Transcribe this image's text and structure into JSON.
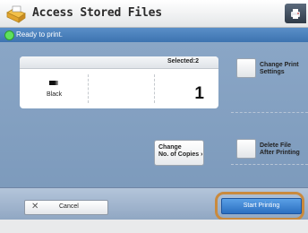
{
  "header": {
    "title": "Access Stored Files",
    "title_icon": "folder-print-icon",
    "corner_icon": "printer-menu-icon"
  },
  "status": {
    "text": "Ready to print.",
    "indicator_color": "#5ee05e"
  },
  "job": {
    "selected_label": "Selected:2",
    "color_mode_label": "Black",
    "copies": "1"
  },
  "buttons": {
    "change_copies_line1": "Change",
    "change_copies_line2": "No. of Copies",
    "change_print_settings_line1": "Change Print",
    "change_print_settings_line2": "Settings",
    "delete_after_printing_line1": "Delete File",
    "delete_after_printing_line2": "After Printing",
    "cancel_label": "Cancel",
    "start_printing_label": "Start Printing"
  },
  "colors": {
    "status_bar": "#3d73b0",
    "panel": "#8aa6c6",
    "start_button": "#2b6fc0",
    "highlight_ring": "#c98a3e"
  }
}
